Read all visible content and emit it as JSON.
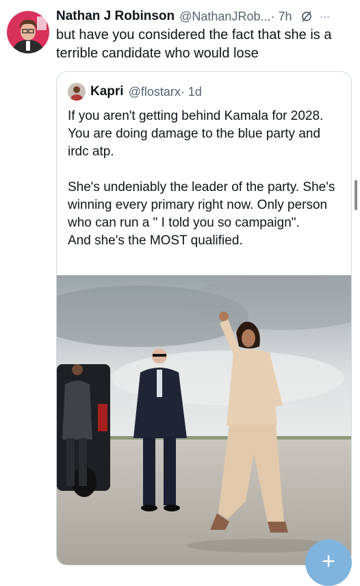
{
  "tweet": {
    "author_name": "Nathan J Robinson",
    "author_handle": "@NathanJRob...",
    "time": "· 7h",
    "text": "but have you considered the fact that she is a terrible candidate who would lose"
  },
  "quote": {
    "author_name": "Kapri",
    "author_handle": "@flostarx",
    "time": "· 1d",
    "text": "If you aren't getting behind Kamala for 2028. You are doing damage to the blue party and irdc atp.\n\nShe's undeniably the leader of the party. She's winning every primary right now. Only person who can run a \" I told you so campaign\".\nAnd she's the MOST qualified.",
    "image_icon": "photo-tarmac-woman-waving"
  },
  "ui": {
    "grok_icon": "grok-slash-icon",
    "more_icon": "more-icon",
    "more_glyph": "···",
    "fab_icon": "plus-icon",
    "fab_glyph": "+",
    "colors": {
      "muted": "#536471",
      "border": "#cfd9de",
      "fab": "#7fb4de"
    }
  }
}
